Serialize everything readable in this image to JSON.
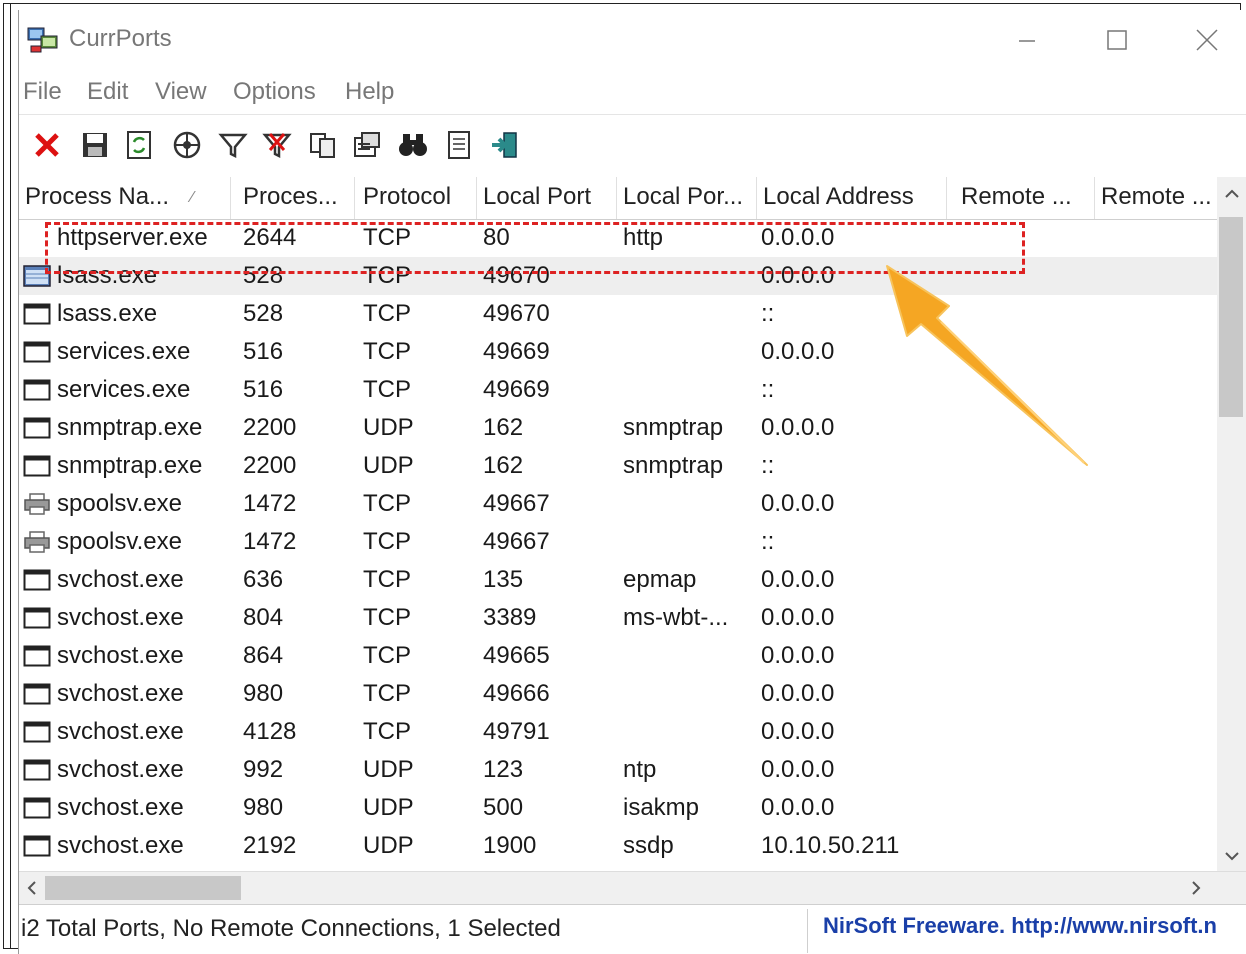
{
  "window": {
    "title": "CurrPorts"
  },
  "menu": [
    "File",
    "Edit",
    "View",
    "Options",
    "Help"
  ],
  "toolbar": [
    "close-connection-icon",
    "save-icon",
    "refresh-icon",
    "properties-network-icon",
    "filter-icon",
    "clear-filter-icon",
    "copy-icon",
    "properties-icon",
    "find-icon",
    "report-icon",
    "exit-icon"
  ],
  "columns": [
    "Process Na...",
    "Proces...",
    "Protocol",
    "Local Port",
    "Local Por...",
    "Local Address",
    "Remote ...",
    "Remote ..."
  ],
  "rows": [
    {
      "name": "httpserver.exe",
      "pid": "2644",
      "protocol": "TCP",
      "port": "80",
      "port_name": "http",
      "address": "0.0.0.0",
      "icon": "none"
    },
    {
      "name": "lsass.exe",
      "pid": "528",
      "protocol": "TCP",
      "port": "49670",
      "port_name": "",
      "address": "0.0.0.0",
      "icon": "app"
    },
    {
      "name": "lsass.exe",
      "pid": "528",
      "protocol": "TCP",
      "port": "49670",
      "port_name": "",
      "address": "::",
      "icon": "window"
    },
    {
      "name": "services.exe",
      "pid": "516",
      "protocol": "TCP",
      "port": "49669",
      "port_name": "",
      "address": "0.0.0.0",
      "icon": "window"
    },
    {
      "name": "services.exe",
      "pid": "516",
      "protocol": "TCP",
      "port": "49669",
      "port_name": "",
      "address": "::",
      "icon": "window"
    },
    {
      "name": "snmptrap.exe",
      "pid": "2200",
      "protocol": "UDP",
      "port": "162",
      "port_name": "snmptrap",
      "address": "0.0.0.0",
      "icon": "window"
    },
    {
      "name": "snmptrap.exe",
      "pid": "2200",
      "protocol": "UDP",
      "port": "162",
      "port_name": "snmptrap",
      "address": "::",
      "icon": "window"
    },
    {
      "name": "spoolsv.exe",
      "pid": "1472",
      "protocol": "TCP",
      "port": "49667",
      "port_name": "",
      "address": "0.0.0.0",
      "icon": "printer"
    },
    {
      "name": "spoolsv.exe",
      "pid": "1472",
      "protocol": "TCP",
      "port": "49667",
      "port_name": "",
      "address": "::",
      "icon": "printer"
    },
    {
      "name": "svchost.exe",
      "pid": "636",
      "protocol": "TCP",
      "port": "135",
      "port_name": "epmap",
      "address": "0.0.0.0",
      "icon": "window"
    },
    {
      "name": "svchost.exe",
      "pid": "804",
      "protocol": "TCP",
      "port": "3389",
      "port_name": "ms-wbt-...",
      "address": "0.0.0.0",
      "icon": "window"
    },
    {
      "name": "svchost.exe",
      "pid": "864",
      "protocol": "TCP",
      "port": "49665",
      "port_name": "",
      "address": "0.0.0.0",
      "icon": "window"
    },
    {
      "name": "svchost.exe",
      "pid": "980",
      "protocol": "TCP",
      "port": "49666",
      "port_name": "",
      "address": "0.0.0.0",
      "icon": "window"
    },
    {
      "name": "svchost.exe",
      "pid": "4128",
      "protocol": "TCP",
      "port": "49791",
      "port_name": "",
      "address": "0.0.0.0",
      "icon": "window"
    },
    {
      "name": "svchost.exe",
      "pid": "992",
      "protocol": "UDP",
      "port": "123",
      "port_name": "ntp",
      "address": "0.0.0.0",
      "icon": "window"
    },
    {
      "name": "svchost.exe",
      "pid": "980",
      "protocol": "UDP",
      "port": "500",
      "port_name": "isakmp",
      "address": "0.0.0.0",
      "icon": "window"
    },
    {
      "name": "svchost.exe",
      "pid": "2192",
      "protocol": "UDP",
      "port": "1900",
      "port_name": "ssdp",
      "address": "10.10.50.211",
      "icon": "window"
    }
  ],
  "selected_row": 1,
  "status": {
    "text": "i2 Total Ports, No Remote Connections, 1 Selected",
    "link": "NirSoft Freeware.  http://www.nirsoft.n"
  },
  "colors": {
    "highlight": "#d22222",
    "arrow": "#f5a623",
    "link": "#1a3fa8"
  }
}
